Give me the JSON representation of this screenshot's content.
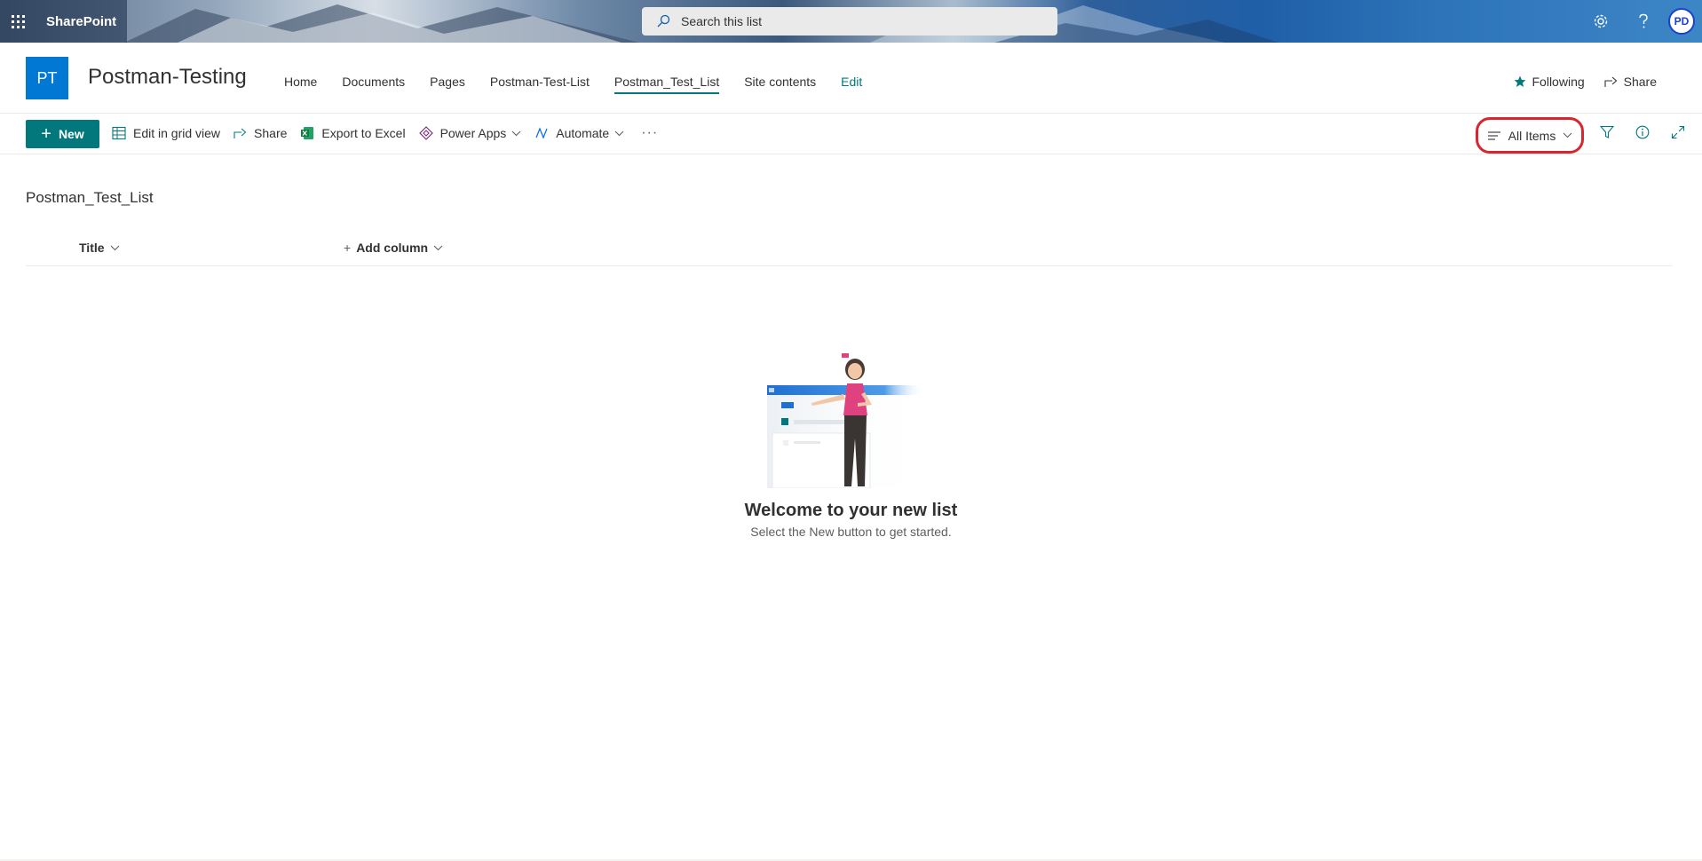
{
  "suite": {
    "brand": "SharePoint",
    "search_placeholder": "Search this list",
    "avatar_initials": "PD"
  },
  "site": {
    "logo_initials": "PT",
    "title": "Postman-Testing",
    "nav": [
      {
        "label": "Home"
      },
      {
        "label": "Documents"
      },
      {
        "label": "Pages"
      },
      {
        "label": "Postman-Test-List"
      },
      {
        "label": "Postman_Test_List",
        "active": true
      },
      {
        "label": "Site contents"
      },
      {
        "label": "Edit"
      }
    ],
    "following_label": "Following",
    "share_label": "Share"
  },
  "commandbar": {
    "new_label": "New",
    "edit_grid_label": "Edit in grid view",
    "share_label": "Share",
    "export_label": "Export to Excel",
    "powerapps_label": "Power Apps",
    "automate_label": "Automate",
    "more_label": "···",
    "view_label": "All Items"
  },
  "list": {
    "title": "Postman_Test_List",
    "columns": [
      {
        "label": "Title"
      },
      {
        "label": "Add column"
      }
    ]
  },
  "empty_state": {
    "title": "Welcome to your new list",
    "subtitle": "Select the New button to get started."
  },
  "colors": {
    "accent": "#03787c",
    "logo": "#0078d4",
    "highlight": "#d62630"
  }
}
